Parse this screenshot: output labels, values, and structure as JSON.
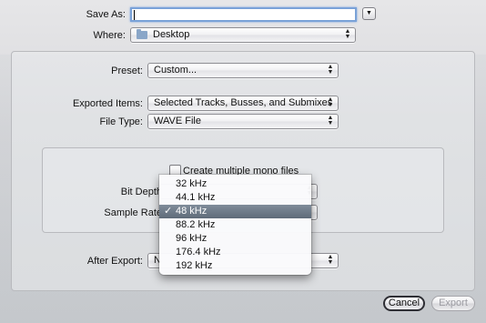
{
  "save_as": {
    "label": "Save As:",
    "value": ""
  },
  "where": {
    "label": "Where:",
    "value": "Desktop"
  },
  "preset": {
    "label": "Preset:",
    "value": "Custom..."
  },
  "exported_items": {
    "label": "Exported Items:",
    "value": "Selected Tracks, Busses, and Submixes"
  },
  "file_type": {
    "label": "File Type:",
    "value": "WAVE File"
  },
  "mono_files": {
    "label": "Create multiple mono files",
    "checked": false
  },
  "bit_depth": {
    "label": "Bit Depth"
  },
  "sample_rate": {
    "label": "Sample Rate",
    "options": [
      "32 kHz",
      "44.1 kHz",
      "48 kHz",
      "88.2 kHz",
      "96 kHz",
      "176.4 kHz",
      "192 kHz"
    ],
    "selected": "48 kHz",
    "check_glyph": "✓"
  },
  "after_export": {
    "label": "After Export:",
    "value": "N"
  },
  "buttons": {
    "cancel": "Cancel",
    "export": "Export"
  },
  "icons": {
    "expand": "disclosure-triangle-icon",
    "folder": "folder-icon",
    "popup_arrows": "updown-arrows-icon"
  }
}
